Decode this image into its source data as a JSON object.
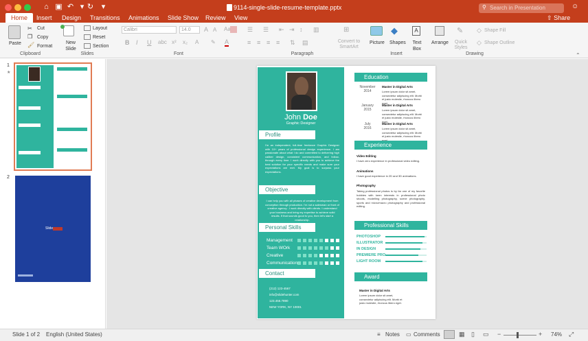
{
  "window": {
    "title": "9114-single-slide-resume-template.pptx",
    "search_placeholder": "Search in Presentation",
    "share_label": "Share"
  },
  "tabs": [
    "Home",
    "Insert",
    "Design",
    "Transitions",
    "Animations",
    "Slide Show",
    "Review",
    "View"
  ],
  "ribbon": {
    "paste": "Paste",
    "cut": "Cut",
    "copy": "Copy",
    "format": "Format",
    "new_slide": "New Slide",
    "layout": "Layout",
    "reset": "Reset",
    "section": "Section",
    "font_name": "Calibri",
    "font_size": "14.0",
    "convert_smartart": "Convert to SmartArt",
    "picture": "Picture",
    "shapes": "Shapes",
    "text_box": "Text Box",
    "arrange": "Arrange",
    "quick_styles": "Quick Styles",
    "shape_fill": "Shape Fill",
    "shape_outline": "Shape Outline",
    "groups": {
      "clipboard": "Clipboard",
      "slides": "Slides",
      "font": "Font",
      "paragraph": "Paragraph",
      "insert": "Insert",
      "drawing": "Drawing"
    }
  },
  "thumbnails": [
    {
      "number": "1"
    },
    {
      "number": "2"
    }
  ],
  "thumbnail2": {
    "title": "Slide"
  },
  "slide": {
    "name": "John Doe",
    "name_first": "John",
    "name_last": "Doe",
    "role": "Graphic Designer",
    "profile_title": "Profile",
    "profile_text": "I'm an independent, full-time freelance Graphic Designer with 10+ years of professional design experience. I am passionate about what I do and committed to delivering high caliber design, consistent communication, and follow-through every time. I work directly with you to achieve the best solution for your specific needs and make sure your expectations are met. My goal is to surpass your expectations.",
    "objective_title": "Objective",
    "objective_text": "I can help you with all phases of creative development from conception through production. I'm not a salesman or front of creative agency - I work directly with clients. I understand your business and bring my expertise to achieve solid results. If that sounds good to you, then let's start a relationship.",
    "skills_title": "Personal Skills",
    "skills": [
      {
        "name": "Management",
        "level": 5
      },
      {
        "name": "Team WOrk",
        "level": 6
      },
      {
        "name": "Creative",
        "level": 4
      },
      {
        "name": "Communication",
        "level": 5
      }
    ],
    "contact_title": "Contact",
    "contact": [
      "(212) 123-4567",
      "info@slidehunter.com",
      "123.456.7890",
      "NEW YORK, NY 10001"
    ],
    "education_title": "Education",
    "education": [
      {
        "month": "November",
        "year": "2014",
        "degree": "Master in Digital Arts",
        "desc": "Lorem ipsum dolor sit amet, consectetur adipiscing elit. Morbi et justo molestie, rhoncus libero eget."
      },
      {
        "month": "January",
        "year": "2015",
        "degree": "Master in Digital Arts",
        "desc": "Lorem ipsum dolor sit amet, consectetur adipiscing elit. Morbi et justo molestie, rhoncus libero eget."
      },
      {
        "month": "July",
        "year": "2016",
        "degree": "Master in Digital Arts",
        "desc": "Lorem ipsum dolor sit amet, consectetur adipiscing elit. Morbi et justo molestie, rhoncus libero eget."
      }
    ],
    "experience_title": "Experience",
    "experience": [
      {
        "title": "Video Editing",
        "text": "I have zero experience in professional video editing."
      },
      {
        "title": "Animations",
        "text": "I have good experience in 2D and 3D animations."
      },
      {
        "title": "Photography",
        "text": "Taking professional photos is by far one of my favorite hobbies with keen interests in professional photo shoots, modelling photography, scene photography, sports and micro/macro photography and professional editing."
      }
    ],
    "pro_skills_title": "Professional Skills",
    "pro_skills": [
      {
        "name": "PHOTOSHOP",
        "level": 0.95
      },
      {
        "name": "ILLUSTRATOR",
        "level": 0.9
      },
      {
        "name": "IN DESIGN",
        "level": 0.85
      },
      {
        "name": "PREMIERE PRO",
        "level": 0.8
      },
      {
        "name": "LIGHT ROOM",
        "level": 0.9
      }
    ],
    "award_title": "Award",
    "award": {
      "degree": "Master in Digital Arts",
      "desc": "Lorem ipsum dolor sit amet, consectetur adipiscing elit. Morbi et justo molestie, rhoncus libero eget."
    }
  },
  "status": {
    "slide": "Slide 1 of 2",
    "language": "English (United States)",
    "notes": "Notes",
    "comments": "Comments",
    "zoom": "74%"
  },
  "colors": {
    "accent": "#c43e1c",
    "teal": "#2fb49e",
    "thumb2_bg": "#1e3f9c"
  }
}
